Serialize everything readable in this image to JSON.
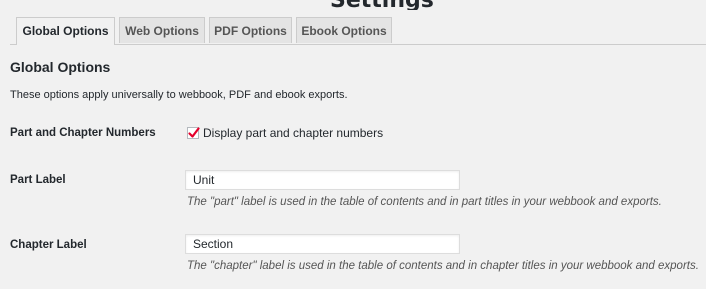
{
  "heading_cut": "Settings",
  "tabs": [
    {
      "label": "Global Options",
      "active": true
    },
    {
      "label": "Web Options",
      "active": false
    },
    {
      "label": "PDF Options",
      "active": false
    },
    {
      "label": "Ebook Options",
      "active": false
    }
  ],
  "section": {
    "title": "Global Options",
    "description": "These options apply universally to webbook, PDF and ebook exports."
  },
  "fields": {
    "part_chapter_numbers": {
      "label": "Part and Chapter Numbers",
      "checkbox_label": "Display part and chapter numbers",
      "checked": true
    },
    "part_label": {
      "label": "Part Label",
      "value": "Unit",
      "help": "The \"part\" label is used in the table of contents and in part titles in your webbook and exports."
    },
    "chapter_label": {
      "label": "Chapter Label",
      "value": "Section",
      "help": "The \"chapter\" label is used in the table of contents and in chapter titles in your webbook and exports."
    }
  },
  "colors": {
    "checkmark": "#e4002b",
    "background": "#f1f1f1"
  }
}
